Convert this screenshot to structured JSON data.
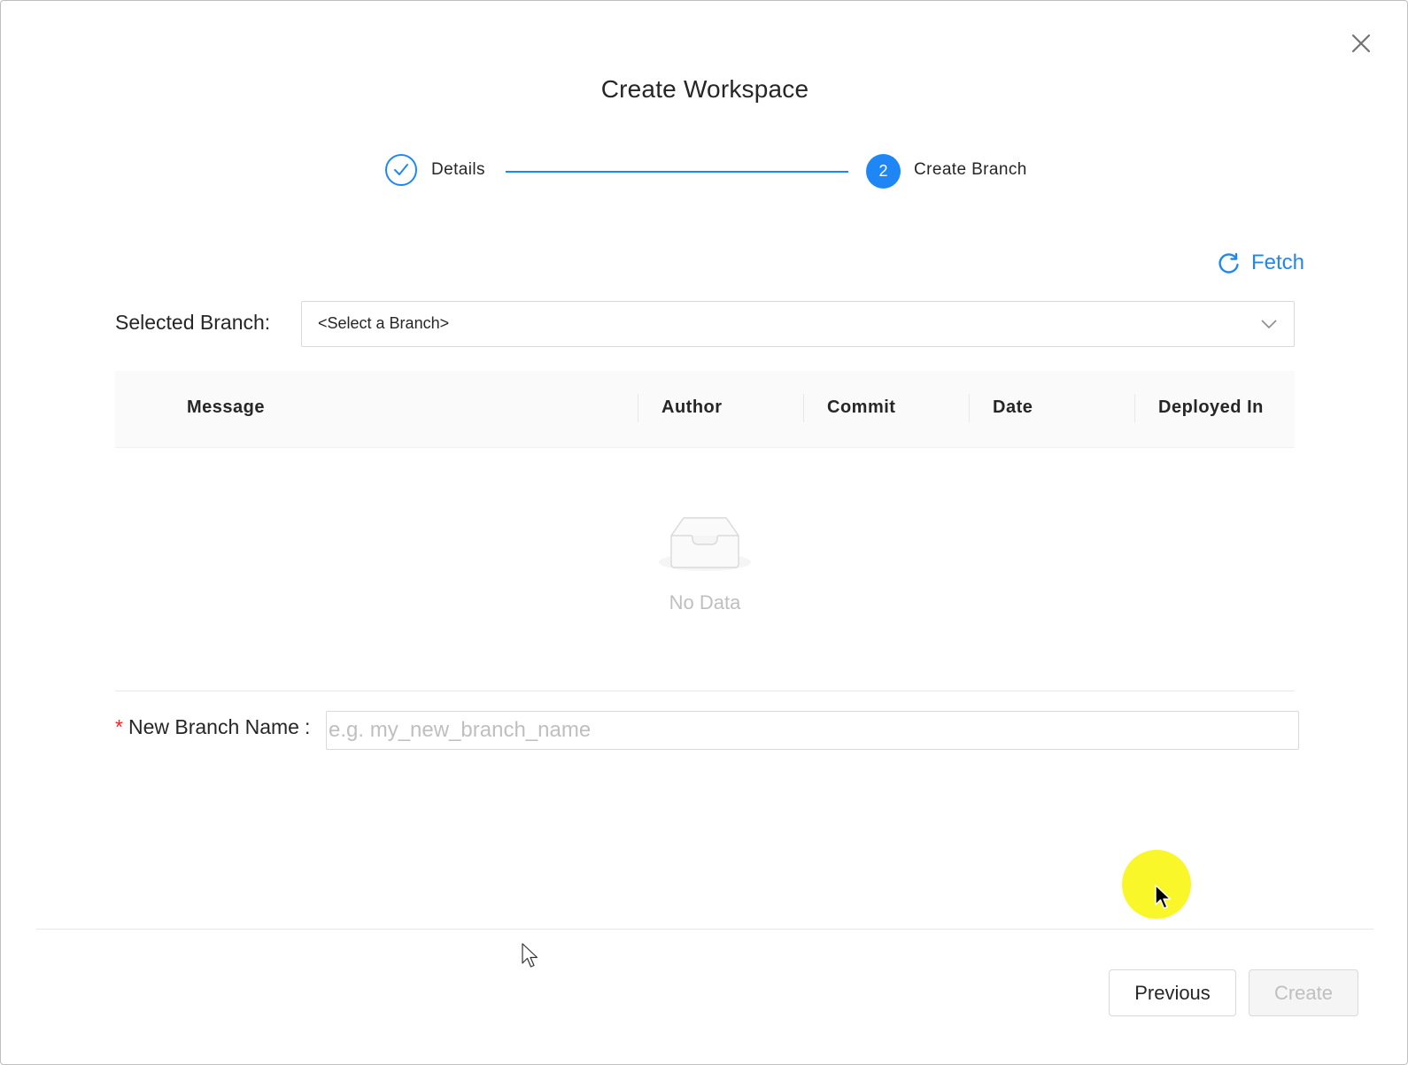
{
  "dialog": {
    "title": "Create Workspace",
    "close_icon": "close-icon"
  },
  "steps": [
    {
      "label": "Details",
      "status": "done",
      "icon": "check-icon"
    },
    {
      "label": "Create Branch",
      "number": "2",
      "status": "active"
    }
  ],
  "fetch": {
    "label": "Fetch",
    "icon": "refresh-icon"
  },
  "selected_branch": {
    "label": "Selected Branch:",
    "value": "<Select a Branch>",
    "icon": "chevron-down-icon"
  },
  "table": {
    "columns": [
      "Message",
      "Author",
      "Commit",
      "Date",
      "Deployed In"
    ],
    "rows": [],
    "empty_text": "No Data",
    "empty_icon": "inbox-icon"
  },
  "new_branch": {
    "required_mark": "*",
    "label": "New Branch Name",
    "colon": ":",
    "value": "",
    "placeholder": "e.g. my_new_branch_name"
  },
  "footer": {
    "previous_label": "Previous",
    "create_label": "Create"
  },
  "colors": {
    "primary": "#1f87f5",
    "required": "#f5222d",
    "cursor_highlight": "#f9f51f"
  }
}
